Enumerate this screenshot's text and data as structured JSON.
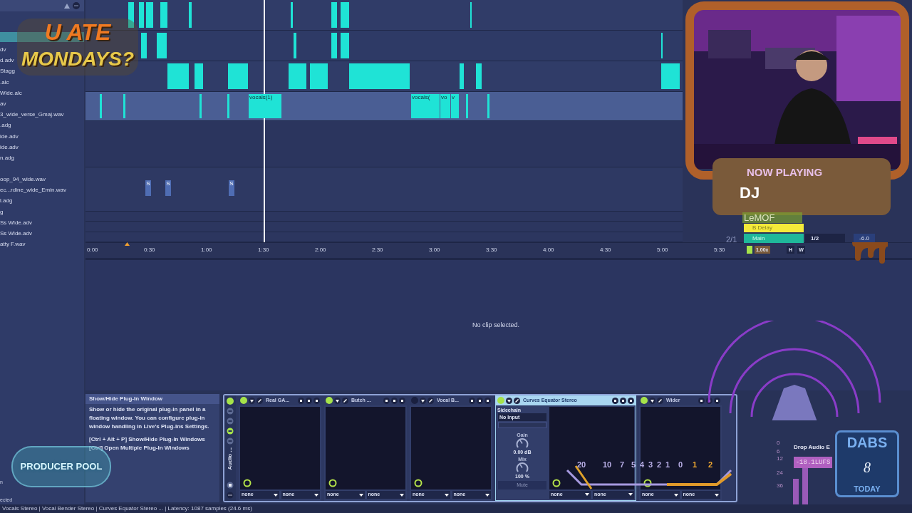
{
  "browser": {
    "groups": [
      [
        "dv",
        "d.adv",
        "Stagg",
        ".alc",
        "Wide.alc",
        "av",
        "3_wide_verse_Gmaj.wav",
        ".adg",
        "ide.adv",
        "ide.adv",
        "n.adg"
      ],
      [
        "oop_94_wide.wav",
        "ec...rdine_wide_Emin.wav",
        "l.adg",
        "g",
        "Ss Wide.adv",
        "Ss Wide.adv",
        "atty F.wav"
      ]
    ],
    "footer": [
      "n",
      "ected"
    ]
  },
  "arrangement": {
    "clips": [
      {
        "label": "vocals(1)"
      },
      {
        "label": "vocals("
      },
      {
        "label": "vo"
      },
      {
        "label": "v"
      }
    ],
    "markers": [
      "S",
      "S",
      "S"
    ],
    "ruler": [
      "0:00",
      "0:30",
      "1:00",
      "1:30",
      "2:00",
      "2:30",
      "3:00",
      "3:30",
      "4:00",
      "4:30",
      "5:00",
      "5:30"
    ]
  },
  "detail": {
    "message": "No clip selected."
  },
  "info": {
    "title": "Show/Hide Plug-In Window",
    "body": "Show or hide the original plug-in panel in a floating window. You can configure plug-in window handling in Live's Plug-Ins Settings.",
    "shortcuts": [
      "[Ctrl + Alt + P] Show/Hide Plug-In Windows",
      "[Ctrl] Open Multiple Plug-In Windows"
    ]
  },
  "rack": {
    "label": "Audio ...",
    "devices": [
      {
        "kind": "plugin",
        "name": "Real GA...",
        "on": true,
        "selected": false,
        "selectors": [
          "none",
          "none"
        ]
      },
      {
        "kind": "plugin",
        "name": "Butch ...",
        "on": true,
        "selected": false,
        "selectors": [
          "none",
          "none"
        ]
      },
      {
        "kind": "plugin",
        "name": "Vocal B...",
        "on": false,
        "selected": false,
        "selectors": [
          "none",
          "none"
        ]
      },
      {
        "kind": "equator",
        "name": "Curves Equator Stereo",
        "on": true,
        "selected": true,
        "selectors": [
          "none",
          "none"
        ],
        "sidechain": {
          "label": "Sidechain",
          "input": "No Input"
        },
        "gain": {
          "label": "Gain",
          "value": "0.00 dB"
        },
        "mix": {
          "label": "Mix",
          "value": "100 %"
        },
        "mute": "Mute"
      },
      {
        "kind": "plugin",
        "name": "Wider",
        "on": true,
        "selected": false,
        "selectors": [
          "none",
          "none"
        ]
      }
    ]
  },
  "status_bar": "Vocals Stereo | Vocal Bender Stereo | Curves Equator Stereo ... | Latency: 1087 samples (24.6 ms)",
  "overlays": {
    "logo": [
      "U ATE",
      "MONDAYS?"
    ],
    "producer_pool": "PRODUCER POOL",
    "now_playing": {
      "heading": "NOW PLAYING",
      "title": "DJ",
      "artist": "LeMOF"
    },
    "mixer": {
      "send": "B Delay",
      "main": "Main",
      "ratio": "2/1",
      "division": "1/2",
      "volume": "-6.0",
      "speed": "1.00x",
      "buttons": [
        "H",
        "W"
      ]
    },
    "vu_scale": [
      "20",
      "10",
      "7",
      "5",
      "4",
      "3",
      "2",
      "1",
      "0",
      "1",
      "2"
    ],
    "loudness": {
      "ticks": [
        "0",
        "6",
        "12",
        "24",
        "36"
      ],
      "label": "Drop Audio E",
      "reading": "-18.1LUFS"
    },
    "dabs": {
      "title": "DABS",
      "count": "8",
      "footer": "TODAY"
    }
  }
}
